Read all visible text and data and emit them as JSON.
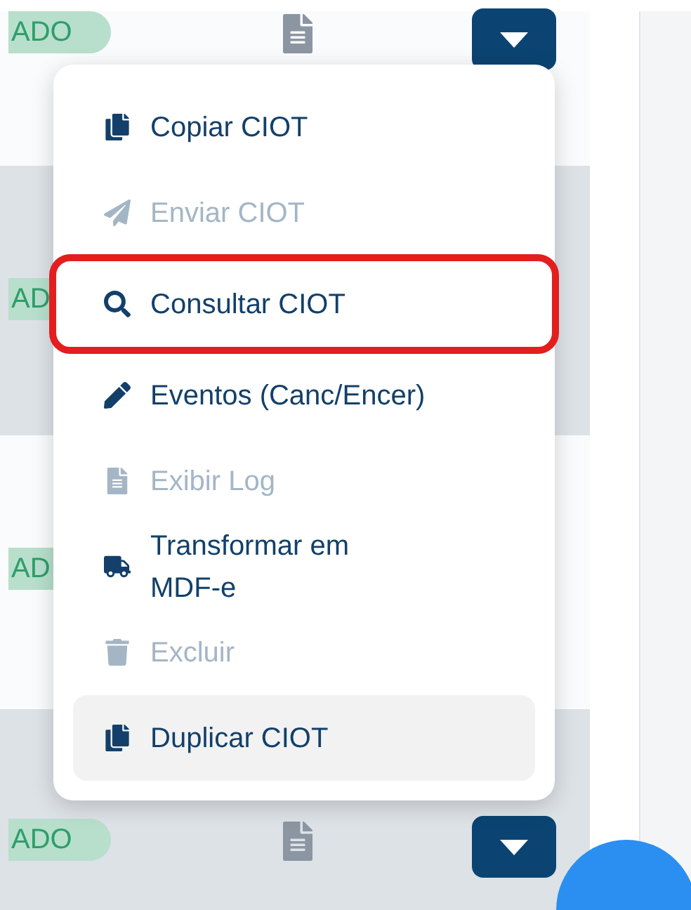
{
  "rows": [
    {
      "badge": "ADO",
      "actions": true
    },
    {
      "badge": "AD"
    },
    {
      "badge": "AD"
    },
    {
      "badge": "ADO",
      "actions": true
    }
  ],
  "menu": {
    "items": [
      {
        "kind": "copy",
        "label": "Copiar CIOT",
        "disabled": false,
        "highlighted": false,
        "hovered": false
      },
      {
        "kind": "send",
        "label": "Enviar CIOT",
        "disabled": true,
        "highlighted": false,
        "hovered": false
      },
      {
        "kind": "search",
        "label": "Consultar CIOT",
        "disabled": false,
        "highlighted": true,
        "hovered": false
      },
      {
        "kind": "edit",
        "label": "Eventos (Canc/Encer)",
        "disabled": false,
        "highlighted": false,
        "hovered": false
      },
      {
        "kind": "log",
        "label": "Exibir Log",
        "disabled": true,
        "highlighted": false,
        "hovered": false
      },
      {
        "kind": "truck",
        "label": "Transformar em MDF-e",
        "disabled": false,
        "highlighted": false,
        "hovered": false
      },
      {
        "kind": "delete",
        "label": "Excluir",
        "disabled": true,
        "highlighted": false,
        "hovered": false
      },
      {
        "kind": "copy",
        "label": "Duplicar CIOT",
        "disabled": false,
        "highlighted": false,
        "hovered": true
      }
    ]
  }
}
